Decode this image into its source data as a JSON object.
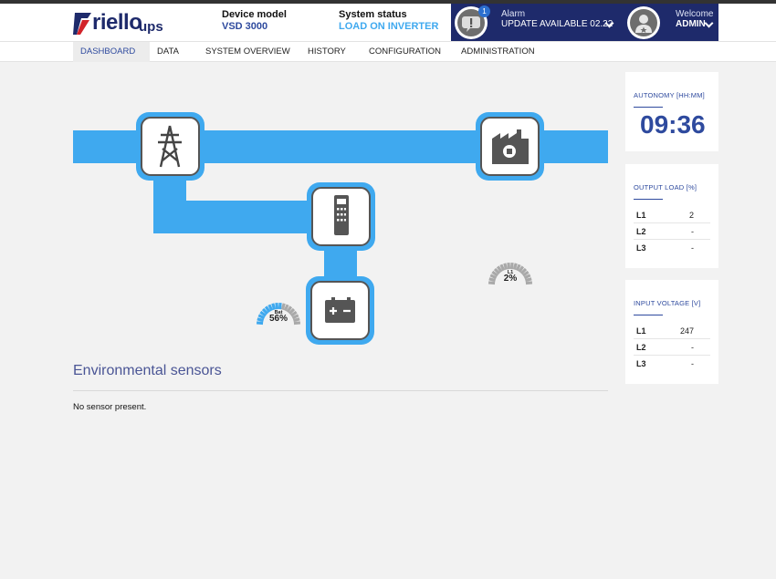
{
  "brand": {
    "logo_text": "riello",
    "logo_suffix": "ups"
  },
  "header": {
    "device_model_label": "Device model",
    "device_model_value": "VSD 3000",
    "system_status_label": "System status",
    "system_status_value": "LOAD ON INVERTER",
    "alarm_count": "1",
    "alarm_label": "Alarm",
    "alarm_value": "UPDATE AVAILABLE 02.22",
    "welcome_label": "Welcome",
    "user": "ADMIN"
  },
  "nav": [
    {
      "label": "DASHBOARD",
      "active": true
    },
    {
      "label": "DATA"
    },
    {
      "label": "SYSTEM OVERVIEW"
    },
    {
      "label": "HISTORY"
    },
    {
      "label": "CONFIGURATION"
    },
    {
      "label": "ADMINISTRATION"
    }
  ],
  "diagram": {
    "battery_gauge": {
      "label": "Bat",
      "value": "56%",
      "fraction": 0.56
    },
    "load_gauge": {
      "label": "L1",
      "value": "2%",
      "fraction": 0.02
    },
    "icons": [
      "pylon-icon",
      "factory-icon",
      "ups-unit-icon",
      "battery-icon"
    ]
  },
  "environment": {
    "title": "Environmental sensors",
    "message": "No sensor present."
  },
  "cards": {
    "autonomy": {
      "title": "AUTONOMY [HH:MM]",
      "value": "09:36"
    },
    "output_load": {
      "title": "OUTPUT LOAD [%]",
      "rows": [
        {
          "k": "L1",
          "v": "2"
        },
        {
          "k": "L2",
          "v": "-"
        },
        {
          "k": "L3",
          "v": "-"
        }
      ]
    },
    "input_voltage": {
      "title": "INPUT VOLTAGE [V]",
      "rows": [
        {
          "k": "L1",
          "v": "247"
        },
        {
          "k": "L2",
          "v": "-"
        },
        {
          "k": "L3",
          "v": "-"
        }
      ]
    }
  },
  "colors": {
    "accent": "#2e4a9e",
    "flow": "#3fa9ef",
    "navy": "#1e2a6b",
    "status": "#3fa9ef"
  }
}
